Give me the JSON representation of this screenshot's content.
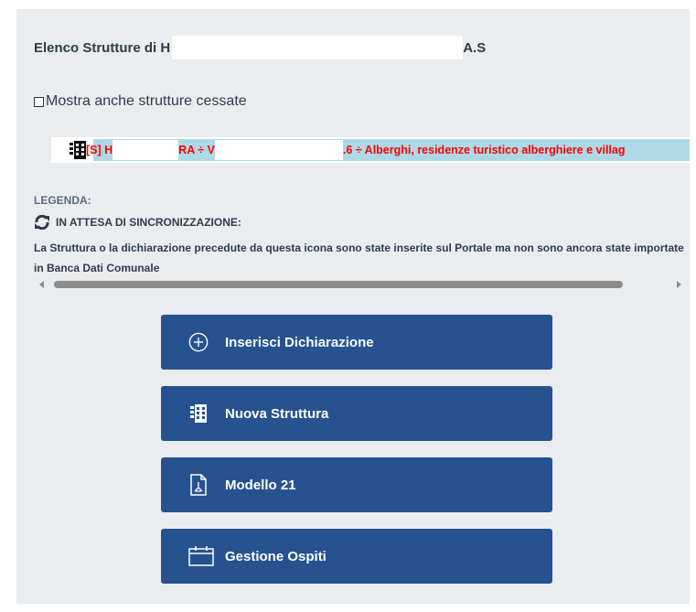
{
  "title": {
    "prefix": "Elenco Strutture di H",
    "suffix": "A.S"
  },
  "checkbox": {
    "label": "Mostra anche strutture cessate",
    "checked": false
  },
  "structure_row": {
    "part1": "[S] H",
    "part2": "RA ÷ V",
    "part3": ".6 ÷ Alberghi, residenze turistico alberghiere e villag"
  },
  "legend": {
    "title": "LEGENDA:",
    "sync_label": "IN ATTESA DI SINCRONIZZAZIONE:",
    "description": "La Struttura o la dichiarazione precedute da questa icona sono state inserite sul Portale ma non sono ancora state importate in Banca Dati Comunale"
  },
  "buttons": {
    "insert": "Inserisci Dichiarazione",
    "new_structure": "Nuova Struttura",
    "modello": "Modello 21",
    "guests": "Gestione Ospiti"
  },
  "colors": {
    "button_bg": "#26528f",
    "panel_bg": "#eaedf0",
    "highlight_bg": "#add8e6",
    "structure_text": "#ff0000"
  },
  "icons": [
    "plus-circle-icon",
    "building-icon",
    "pdf-file-icon",
    "calendar-icon",
    "sync-icon"
  ]
}
